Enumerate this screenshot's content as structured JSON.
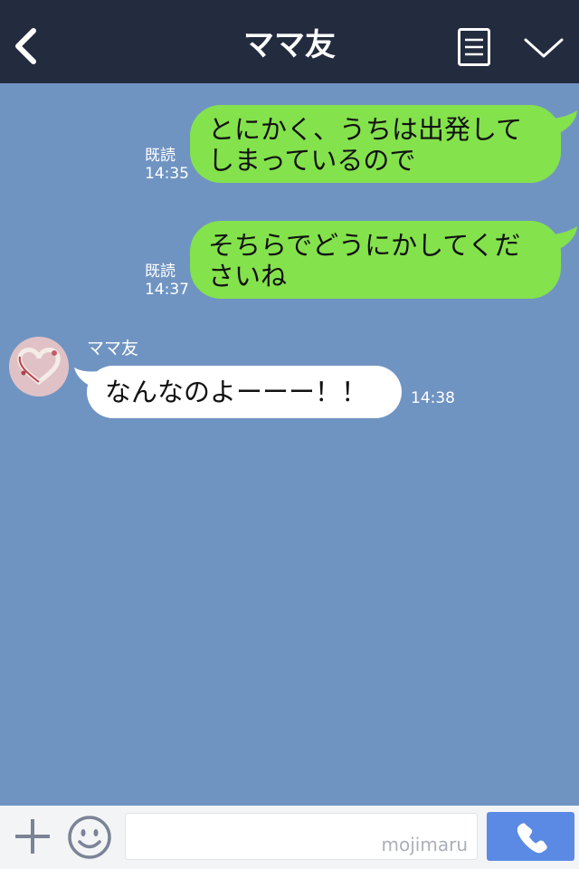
{
  "header": {
    "title": "ママ友",
    "back_icon": "chevron-left-icon",
    "menu_icon": "list-icon",
    "collapse_icon": "chevron-down-icon"
  },
  "messages": [
    {
      "direction": "outgoing",
      "lines": [
        "とにかく、うちは出発して",
        "しまっているので"
      ],
      "read_label": "既読",
      "time": "14:35"
    },
    {
      "direction": "outgoing",
      "lines": [
        "そちらでどうにかしてくだ",
        "さいね"
      ],
      "read_label": "既読",
      "time": "14:37"
    },
    {
      "direction": "incoming",
      "sender": "ママ友",
      "lines": [
        "なんなのよーーー！！"
      ],
      "time": "14:38"
    }
  ],
  "input_bar": {
    "plus_icon": "plus-icon",
    "emoji_icon": "smiley-icon",
    "watermark": "mojimaru",
    "call_icon": "phone-icon"
  },
  "colors": {
    "header_bg": "#232b3f",
    "chat_bg": "#7094c2",
    "outgoing_bubble": "#84e24c",
    "incoming_bubble": "#ffffff",
    "call_button": "#5b8ae4"
  }
}
